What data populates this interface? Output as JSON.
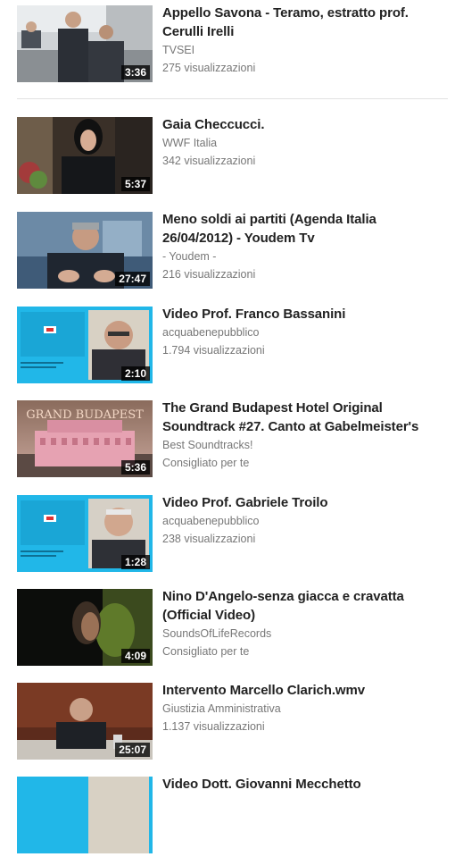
{
  "videos": [
    {
      "title": "Appello Savona - Teramo, estratto prof. Cerulli Irelli",
      "channel": "TVSEI",
      "extra": "275 visualizzazioni",
      "duration": "3:36"
    },
    {
      "title": "Gaia Checcucci.",
      "channel": "WWF Italia",
      "extra": "342 visualizzazioni",
      "duration": "5:37"
    },
    {
      "title": "Meno soldi ai partiti (Agenda Italia 26/04/2012) - Youdem Tv",
      "channel": "- Youdem -",
      "extra": "216 visualizzazioni",
      "duration": "27:47"
    },
    {
      "title": "Video Prof. Franco Bassanini",
      "channel": "acquabenepubblico",
      "extra": "1.794 visualizzazioni",
      "duration": "2:10"
    },
    {
      "title": "The Grand Budapest Hotel Original Soundtrack #27. Canto at Gabelmeister's",
      "channel": "Best Soundtracks!",
      "extra": "Consigliato per te",
      "duration": "5:36"
    },
    {
      "title": "Video Prof. Gabriele Troilo",
      "channel": "acquabenepubblico",
      "extra": "238 visualizzazioni",
      "duration": "1:28"
    },
    {
      "title": "Nino D'Angelo-senza giacca e cravatta (Official Video)",
      "channel": "SoundsOfLifeRecords",
      "extra": "Consigliato per te",
      "duration": "4:09"
    },
    {
      "title": "Intervento Marcello Clarich.wmv",
      "channel": "Giustizia Amministrativa",
      "extra": "1.137 visualizzazioni",
      "duration": "25:07"
    },
    {
      "title": "Video Dott. Giovanni Mecchetto",
      "channel": "",
      "extra": "",
      "duration": ""
    }
  ],
  "thumbnail_text": {
    "v4": "COMITATO NAZIONALE PER IL SÌ AI REFERENDUM SUI SERVIZI PUBBLICI LOCALI E L'ACQUA PUBBLICA",
    "v5": "GRAND BUDAPEST",
    "v6": "COMITATO NAZIONALE PER IL SÌ AI REFERENDUM SUI SERVIZI PUBBLICI LOCALI E L'ACQUA PUBBLICA"
  },
  "colors": {
    "title": "#222222",
    "meta": "#777777",
    "duration_bg": "#000000",
    "acqua_blue": "#21b7e8"
  }
}
